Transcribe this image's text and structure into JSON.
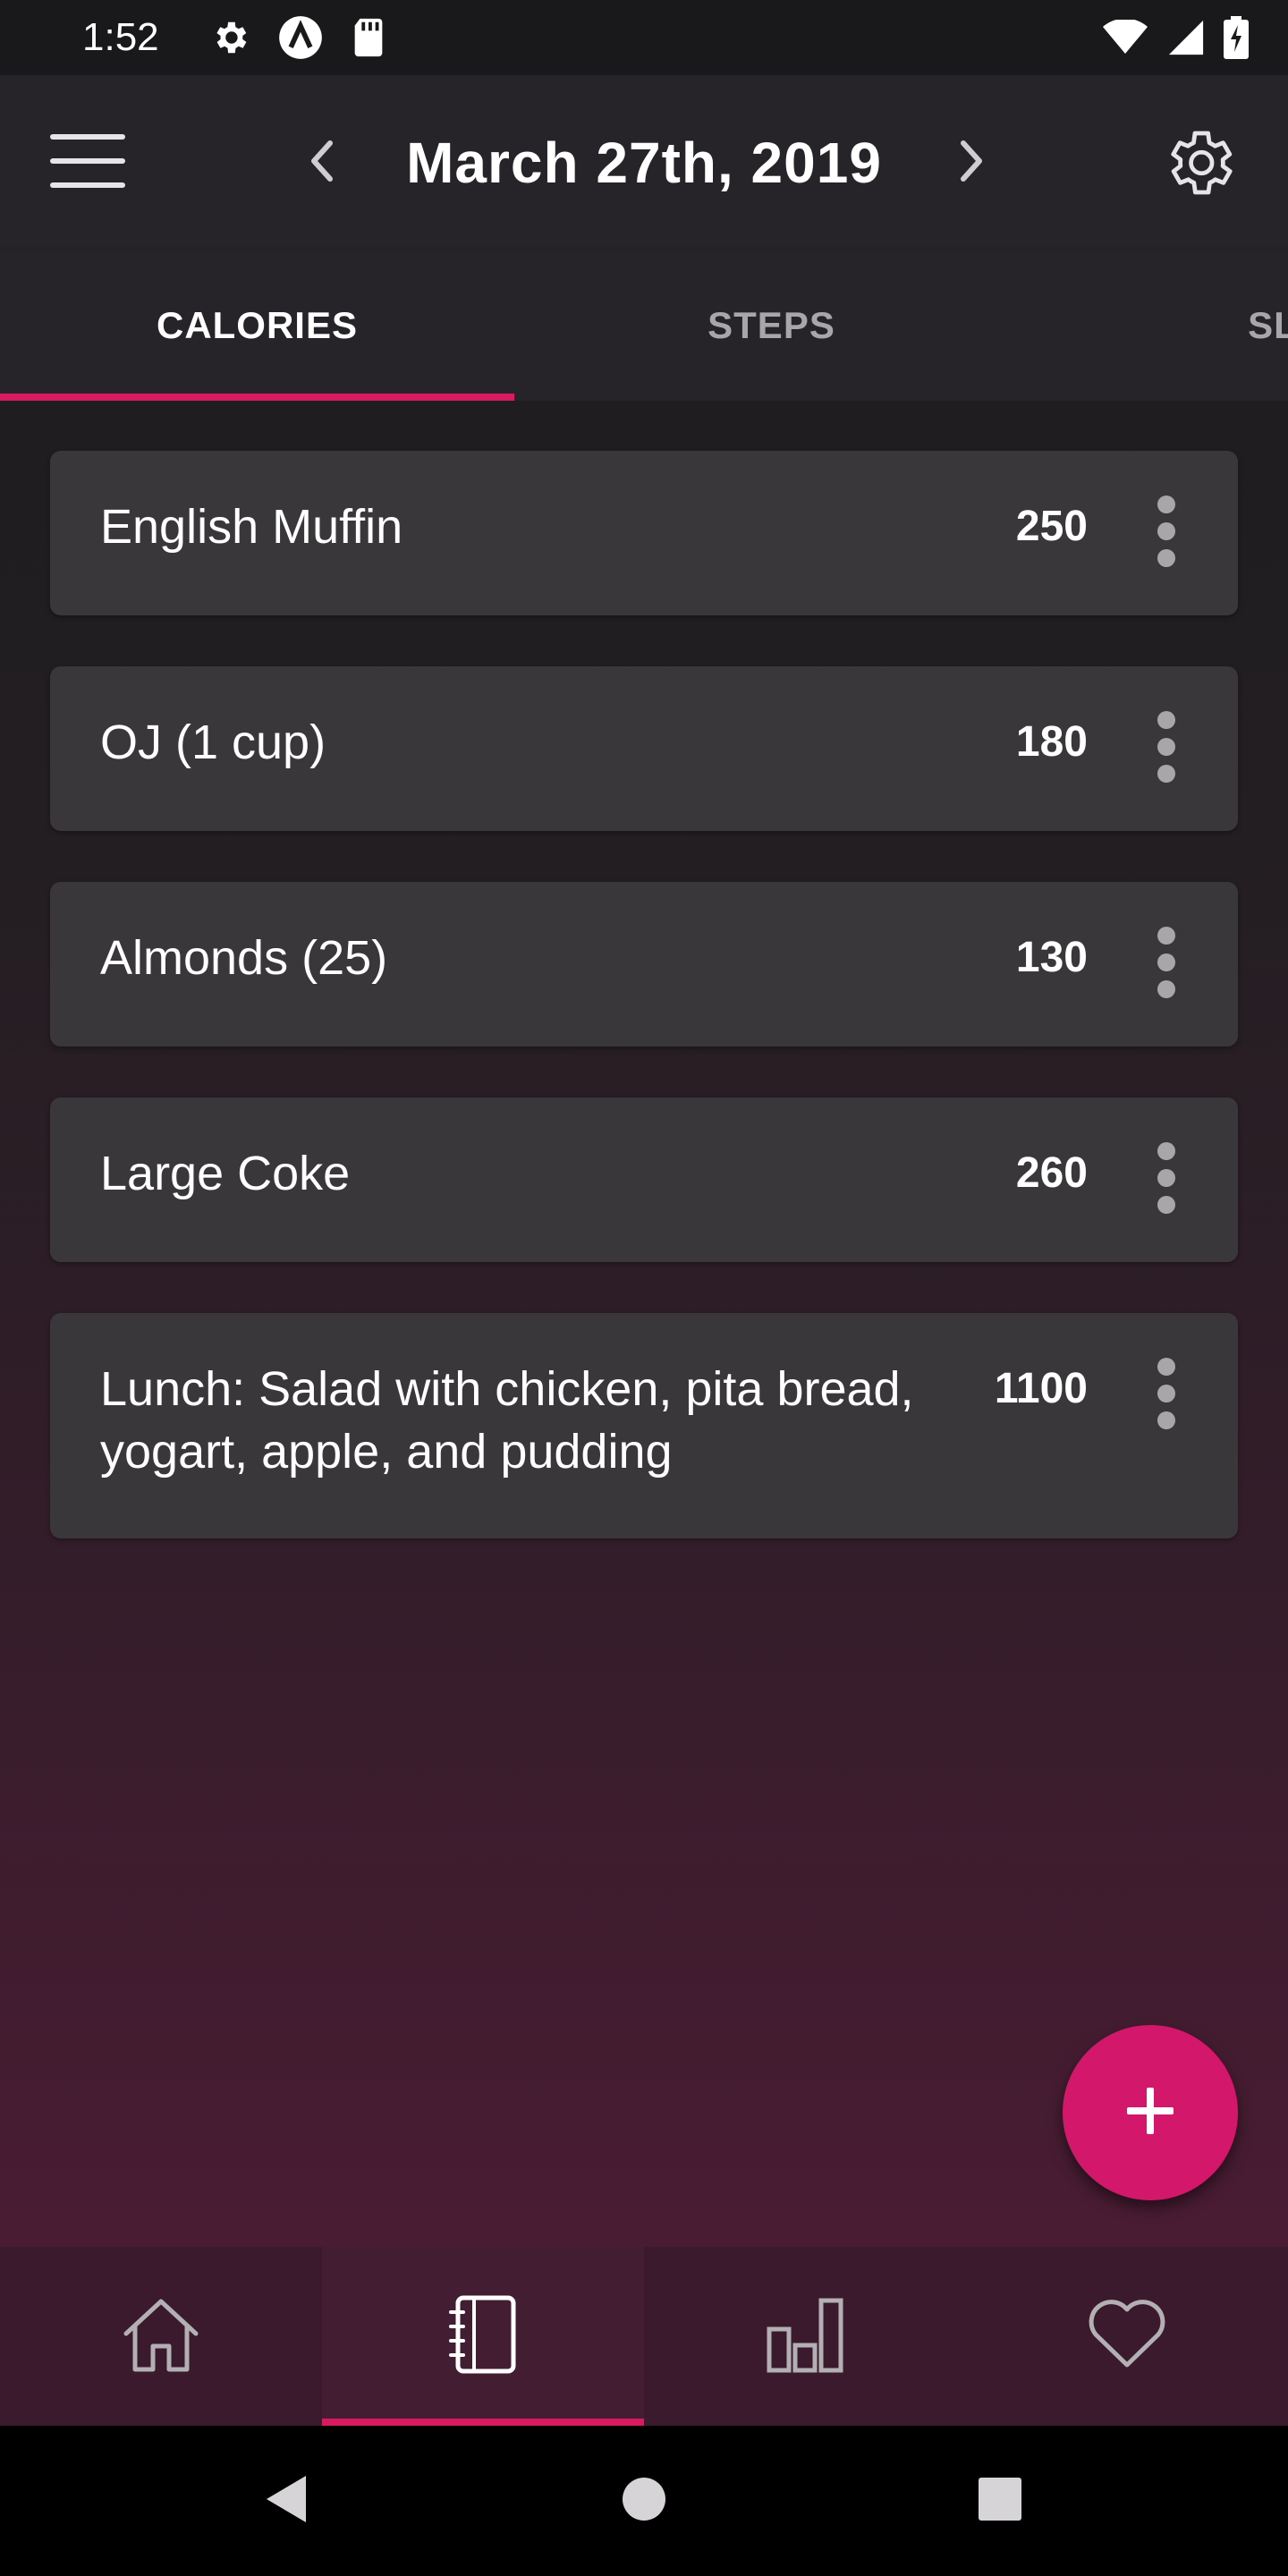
{
  "status_bar": {
    "time": "1:52",
    "left_icons": [
      "gear-icon",
      "a-logo-icon",
      "sd-card-icon"
    ],
    "right_icons": [
      "wifi-icon",
      "cell-signal-icon",
      "battery-icon"
    ]
  },
  "app_bar": {
    "date": "March 27th, 2019",
    "menu_icon": "hamburger-menu-icon",
    "prev_icon": "chevron-left-icon",
    "next_icon": "chevron-right-icon",
    "settings_icon": "gear-icon"
  },
  "tabs": [
    {
      "label": "CALORIES",
      "active": true
    },
    {
      "label": "STEPS",
      "active": false
    },
    {
      "label": "SLE",
      "active": false
    }
  ],
  "entries": [
    {
      "name": "English Muffin",
      "calories": "250"
    },
    {
      "name": "OJ (1 cup)",
      "calories": "180"
    },
    {
      "name": "Almonds (25)",
      "calories": "130"
    },
    {
      "name": "Large Coke",
      "calories": "260"
    },
    {
      "name": "Lunch: Salad with chicken, pita bread, yogart, apple, and pudding",
      "calories": "1100"
    }
  ],
  "fab": {
    "icon": "plus-icon"
  },
  "bottom_nav": [
    {
      "icon": "home-icon",
      "active": false
    },
    {
      "icon": "journal-icon",
      "active": true
    },
    {
      "icon": "bar-chart-icon",
      "active": false
    },
    {
      "icon": "heart-icon",
      "active": false
    }
  ],
  "system_nav": [
    "back-icon",
    "home-circle-icon",
    "recents-icon"
  ],
  "colors": {
    "accent": "#d81b60",
    "fab": "#d3176b",
    "app_bar": "#262428",
    "card": "#3a373b",
    "bottom_nav": "#3a1a2c"
  }
}
